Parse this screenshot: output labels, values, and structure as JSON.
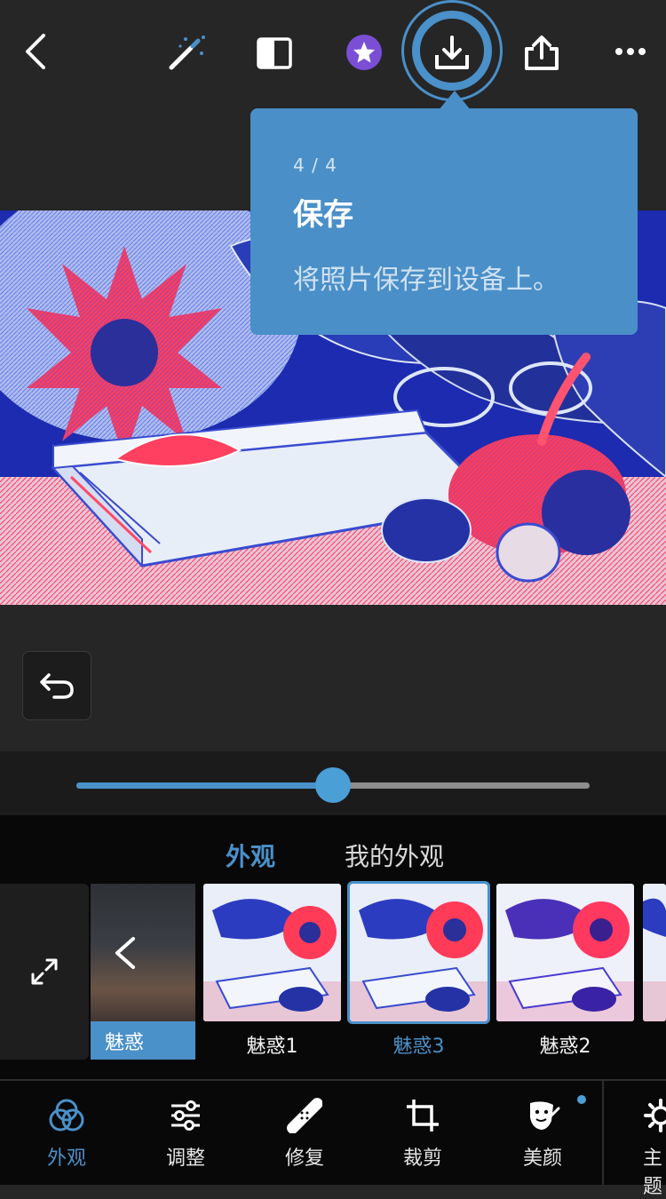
{
  "toolbar": {
    "back_icon": "chevron-left-icon",
    "items": [
      "magic-wand-icon",
      "compare-icon",
      "premium-star-icon",
      "save-download-icon",
      "share-icon",
      "more-icon"
    ]
  },
  "tooltip": {
    "step": "4 / 4",
    "title": "保存",
    "description": "将照片保存到设备上。"
  },
  "slider": {
    "value_fraction": 0.5
  },
  "looks": {
    "tabs": [
      {
        "label": "外观",
        "active": true
      },
      {
        "label": "我的外观",
        "active": false
      }
    ],
    "category": "魅惑",
    "presets": [
      {
        "label": "魅惑1",
        "selected": false
      },
      {
        "label": "魅惑3",
        "selected": true
      },
      {
        "label": "魅惑2",
        "selected": false
      }
    ]
  },
  "bottom_nav": {
    "items": [
      {
        "label": "外观",
        "icon": "looks-icon",
        "active": true
      },
      {
        "label": "调整",
        "icon": "sliders-icon",
        "active": false
      },
      {
        "label": "修复",
        "icon": "bandage-icon",
        "active": false
      },
      {
        "label": "裁剪",
        "icon": "crop-icon",
        "active": false
      },
      {
        "label": "美颜",
        "icon": "face-icon",
        "active": false
      },
      {
        "label": "主题",
        "icon": "gear-icon",
        "active": false
      }
    ]
  },
  "colors": {
    "accent": "#4a90c9",
    "tooltip_bg": "#4a8fc8",
    "background": "#262626",
    "panel": "#080808",
    "premium": "#7a4fd6"
  }
}
